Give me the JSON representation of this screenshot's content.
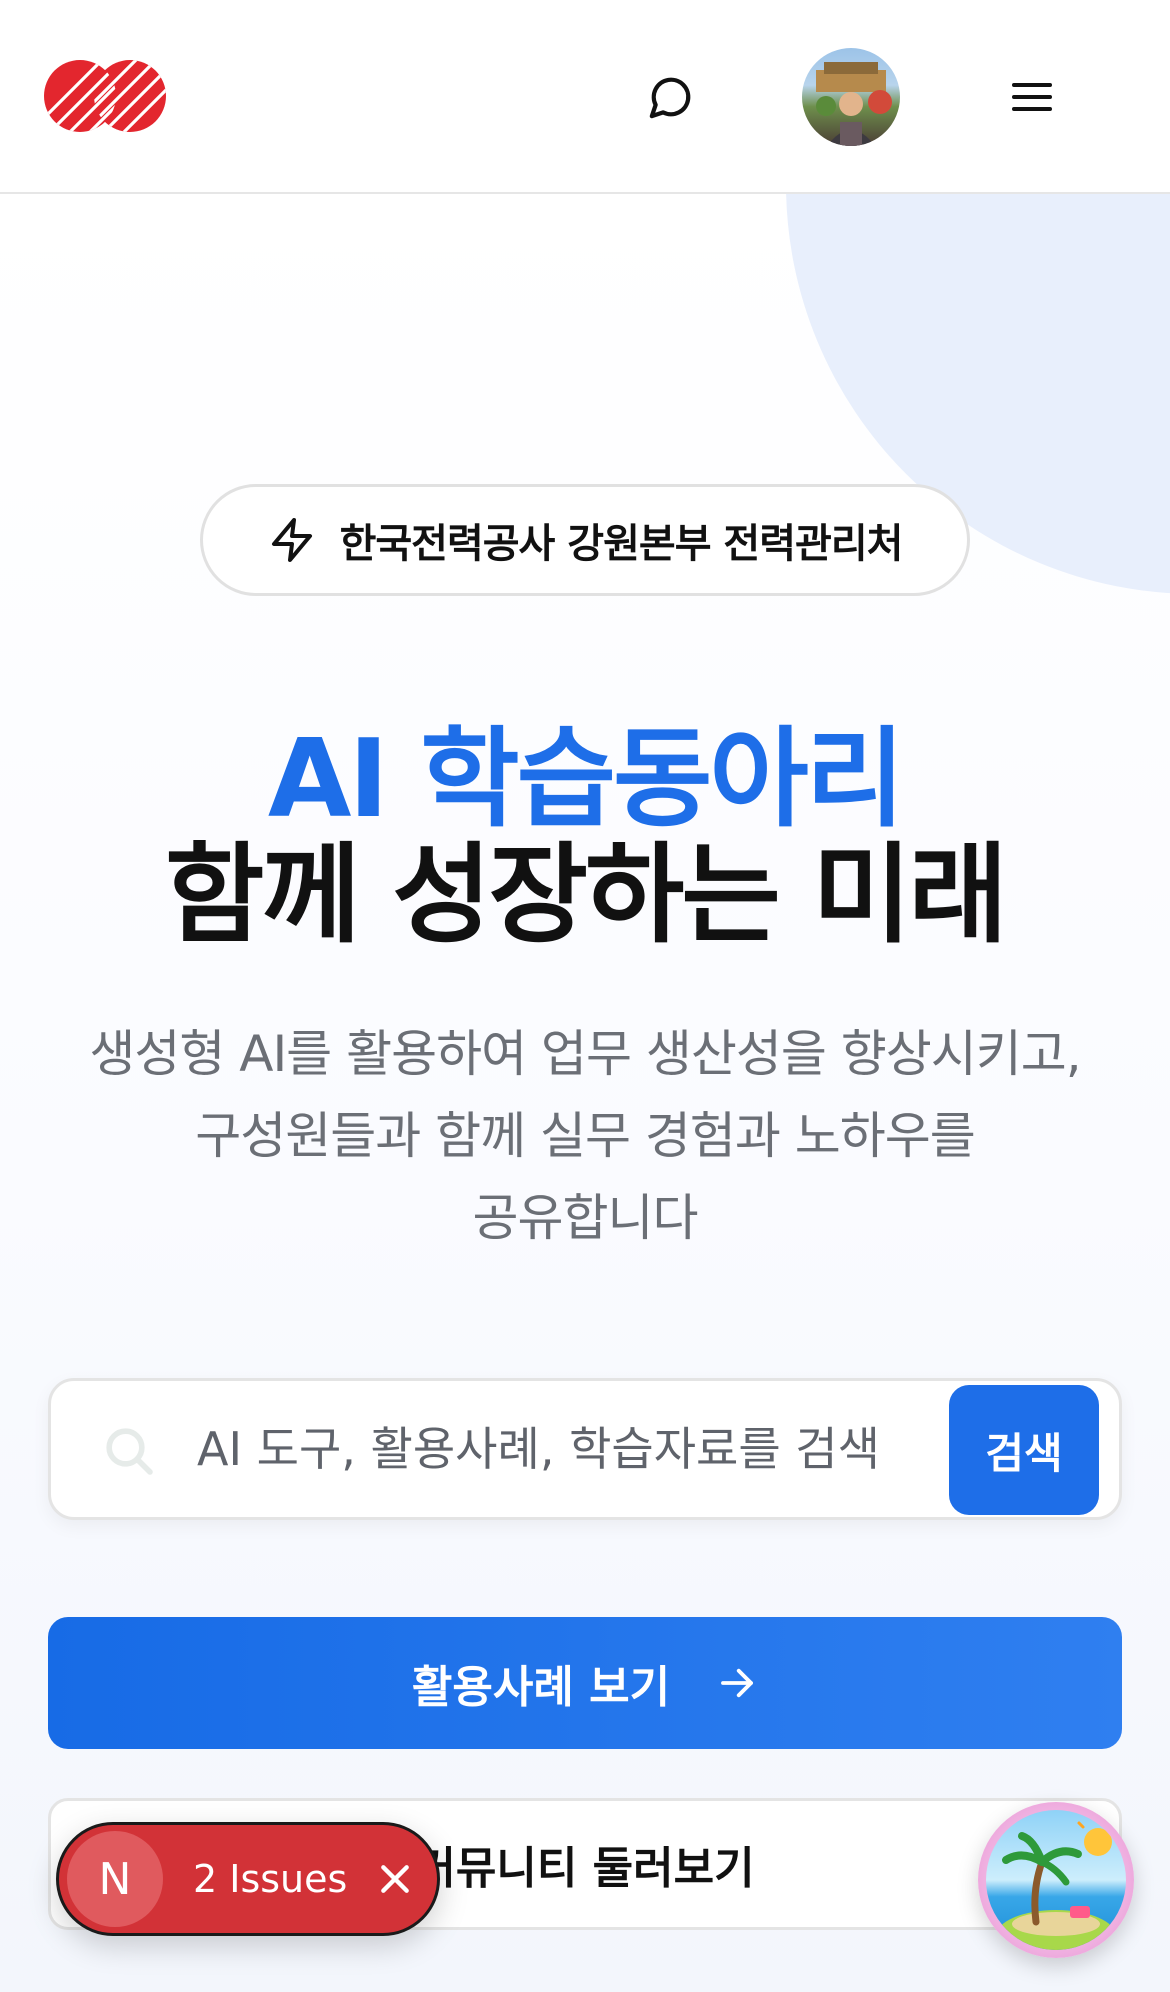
{
  "header": {
    "logo_icon": "kepco-logo-icon",
    "chat_icon": "chat-bubble-icon",
    "avatar_icon": "user-avatar",
    "menu_icon": "hamburger-menu-icon"
  },
  "hero": {
    "badge": {
      "icon": "lightning-icon",
      "text": "한국전력공사 강원본부 전력관리처"
    },
    "title_line1": "AI 학습동아리",
    "title_line2": "함께 성장하는 미래",
    "description_lines": [
      "생성형 AI를 활용하여 업무 생산성을 향상시키고,",
      "구성원들과 함께 실무 경험과 노하우를",
      "공유합니다"
    ],
    "search": {
      "placeholder": "AI 도구, 활용사례, 학습자료를 검색",
      "value": "",
      "button_label": "검색"
    },
    "cta_primary": {
      "label": "활용사례 보기",
      "icon": "arrow-right-icon"
    },
    "cta_secondary": {
      "label": "커뮤니티 둘러보기"
    }
  },
  "overlays": {
    "issues_badge": {
      "letter": "N",
      "text": "2 Issues",
      "close_icon": "close-icon"
    },
    "floating_button_icon": "island-palm-icon"
  },
  "colors": {
    "accent": "#1e6ee8",
    "logo_red": "#e3262e",
    "issues_red": "#d23237",
    "text_dark": "#111111",
    "text_muted": "#6b6f76"
  }
}
